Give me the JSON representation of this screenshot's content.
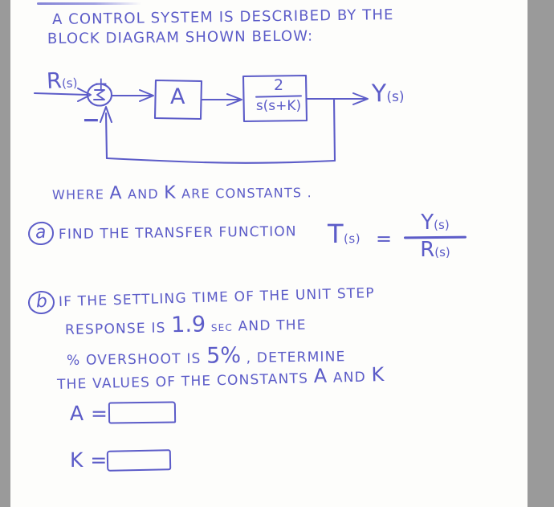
{
  "page": {
    "background_color": "#fdfdfb",
    "border_color": "#9a9a9a",
    "ink_color": "#5c5cc8"
  },
  "prompt": {
    "line1": "A CONTROL SYSTEM IS DESCRIBED BY THE",
    "line2": "BLOCK DIAGRAM SHOWN BELOW:"
  },
  "diagram": {
    "input_label": "R",
    "input_sub": "(s)",
    "output_label": "Y",
    "output_sub": "(s)",
    "plus_sign": "+",
    "minus_sign": "−",
    "summing_symbol": "Σ",
    "gain_block_label": "A",
    "plant_numerator": "2",
    "plant_denominator": "s(s+K)"
  },
  "where_note": {
    "prefix": "WHERE",
    "constant_1": "A",
    "conjunction": "AND",
    "constant_2": "K",
    "suffix": "ARE CONSTANTS ."
  },
  "part_a": {
    "label": "a",
    "text": "FIND THE TRANSFER FUNCTION",
    "tf_symbol": "T",
    "tf_sub": "(s)",
    "equals": "=",
    "numerator": "Y",
    "numerator_sub": "(s)",
    "denominator": "R",
    "denominator_sub": "(s)"
  },
  "part_b": {
    "label": "b",
    "line1": "IF THE SETTLING TIME OF THE UNIT STEP",
    "line2_pre": "RESPONSE IS",
    "settling_time": "1.9",
    "line2_post": "sec AND THE",
    "line3_pre": "% OVERSHOOT IS",
    "overshoot": "5%",
    "line3_post": ", DETERMINE",
    "line4_pre": "THE VALUES OF THE CONSTANTS",
    "constant_1": "A",
    "conjunction": "AND",
    "constant_2": "K"
  },
  "answers": [
    {
      "label": "A =",
      "value": "",
      "name": "answer-a"
    },
    {
      "label": "K =",
      "value": "",
      "name": "answer-k"
    }
  ]
}
